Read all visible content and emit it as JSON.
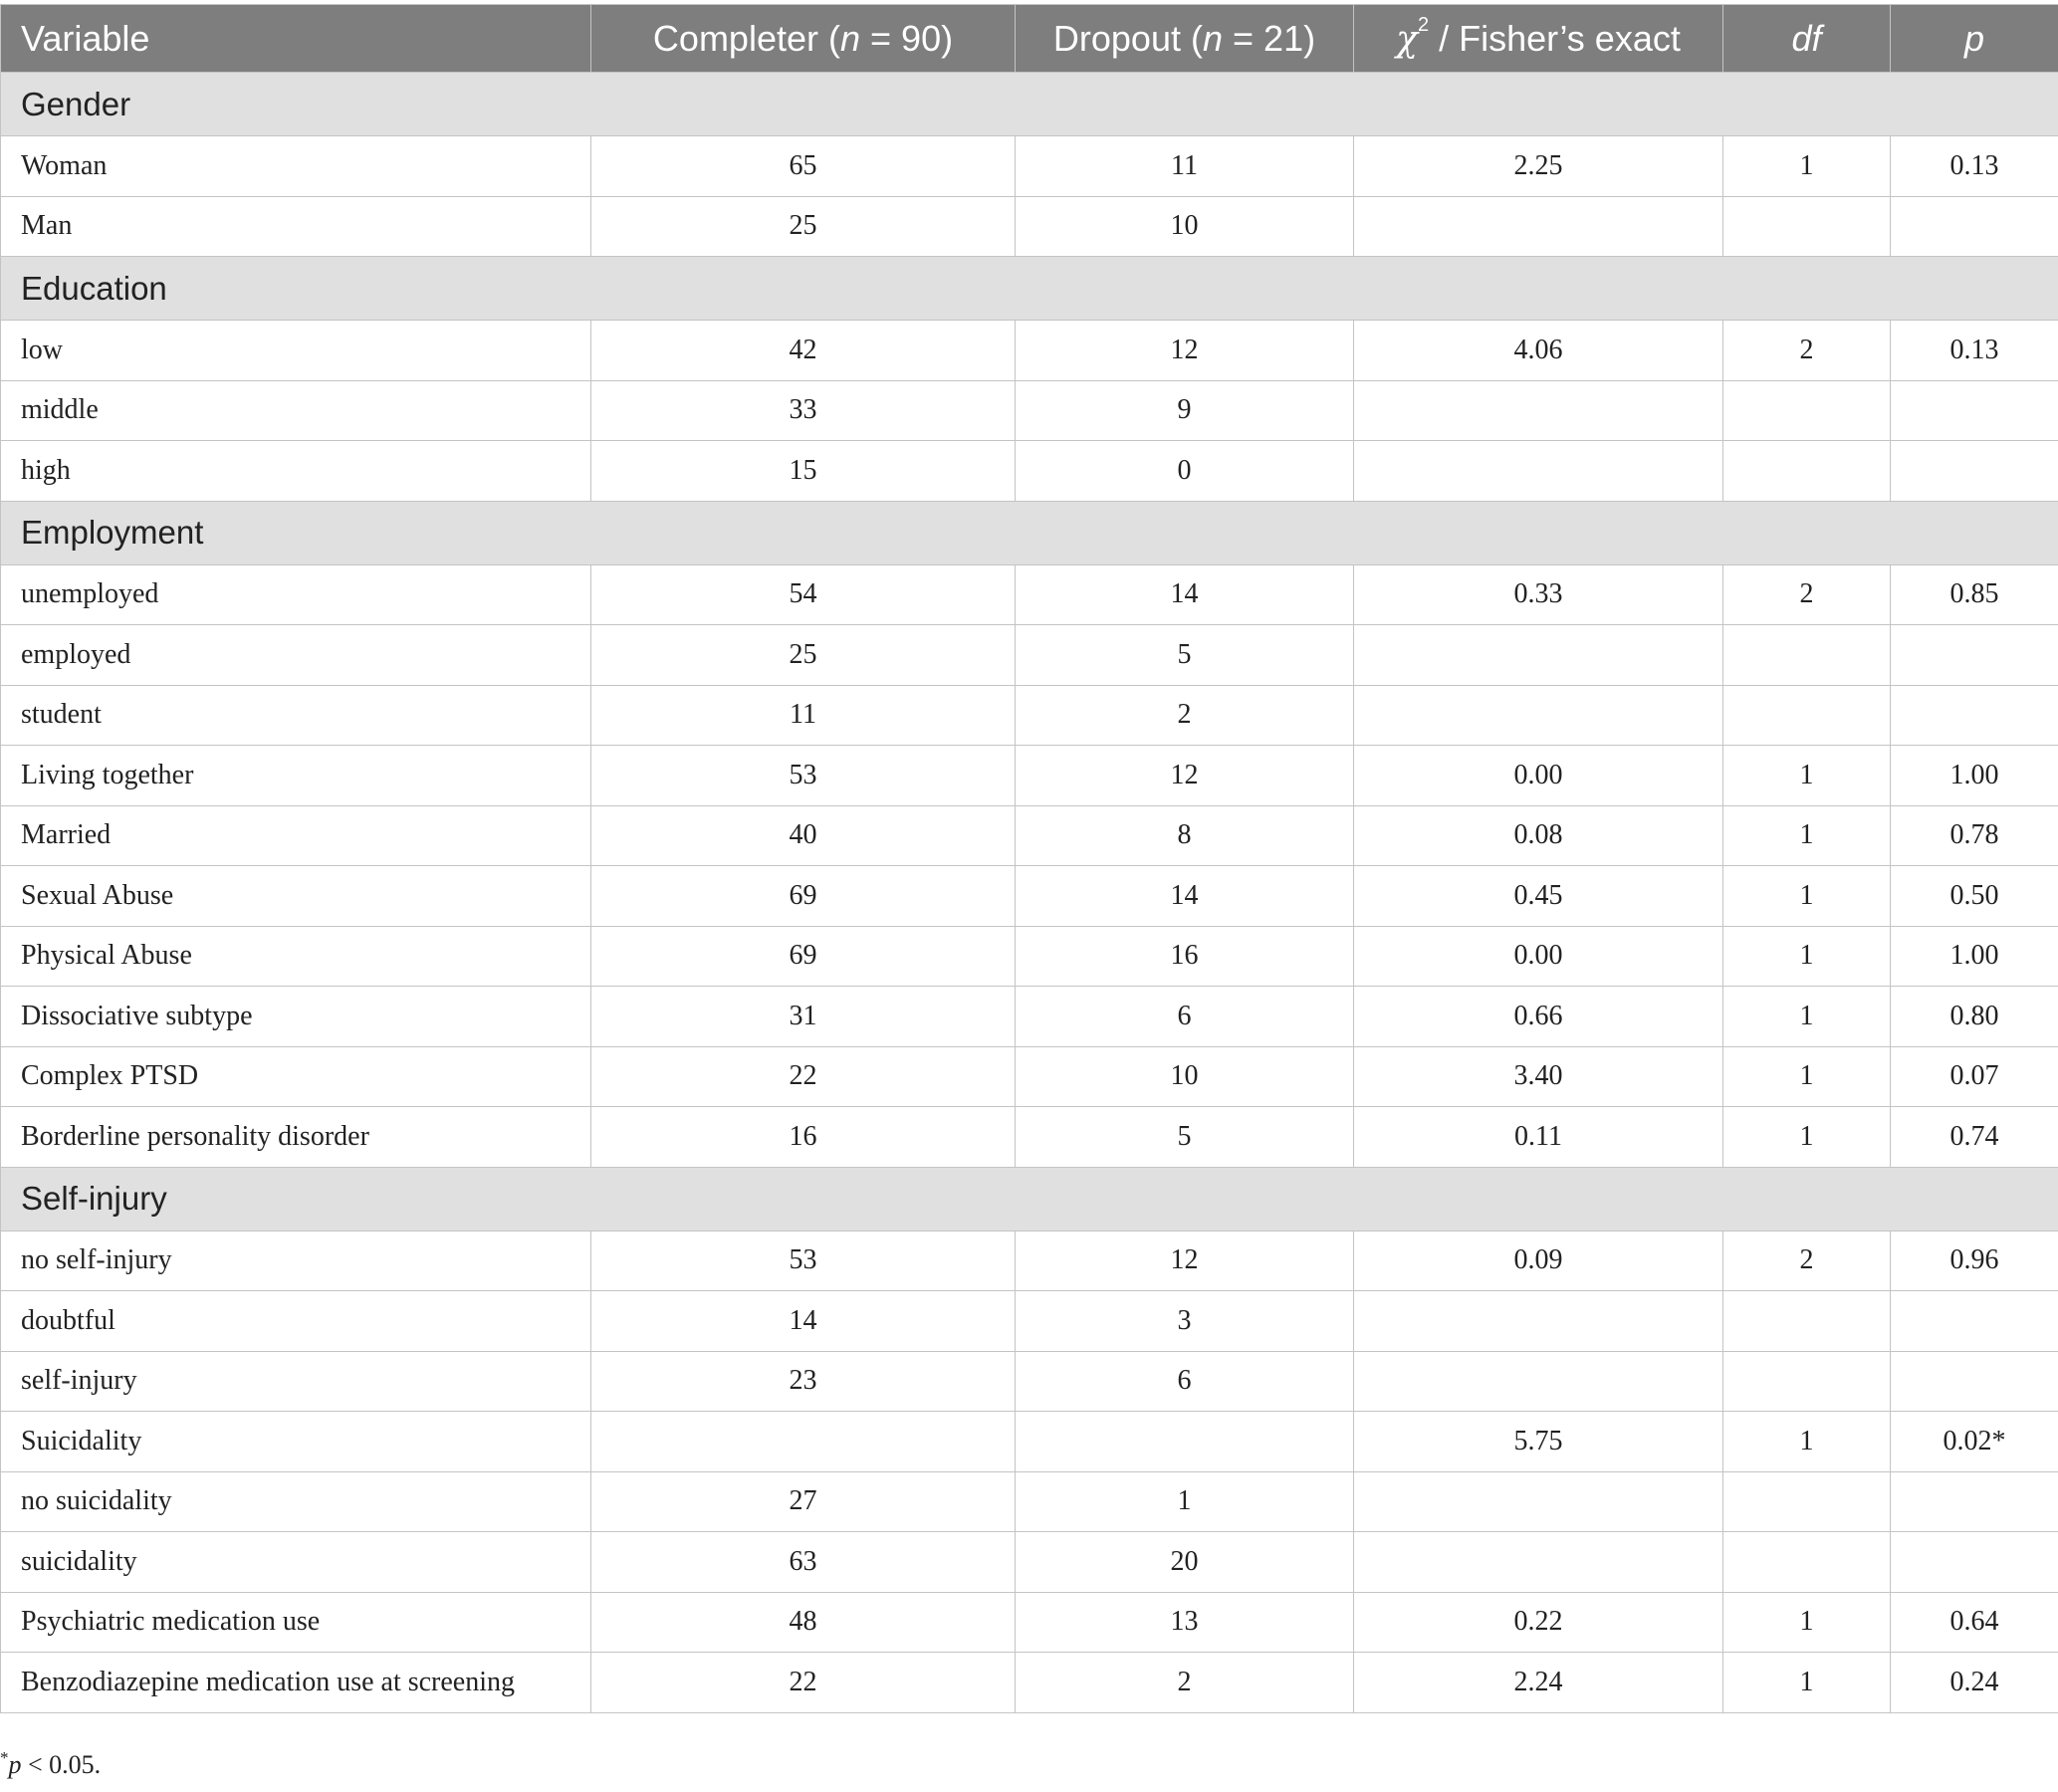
{
  "columns": {
    "variable": "Variable",
    "completer_prefix": "Completer (",
    "completer_n": "n",
    "completer_suffix": " = 90)",
    "dropout_prefix": "Dropout (",
    "dropout_n": "n",
    "dropout_suffix": " = 21)",
    "chi_symbol": "χ",
    "chi_superscript": "2",
    "chi_suffix": " / Fisher’s exact",
    "df": "df",
    "p": "p"
  },
  "rows": [
    {
      "section": "Gender"
    },
    {
      "label": "Woman",
      "completer": "65",
      "dropout": "11",
      "chi": "2.25",
      "df": "1",
      "p": "0.13"
    },
    {
      "label": "Man",
      "completer": "25",
      "dropout": "10",
      "chi": "",
      "df": "",
      "p": ""
    },
    {
      "section": "Education"
    },
    {
      "label": "low",
      "completer": "42",
      "dropout": "12",
      "chi": "4.06",
      "df": "2",
      "p": "0.13"
    },
    {
      "label": "middle",
      "completer": "33",
      "dropout": "9",
      "chi": "",
      "df": "",
      "p": ""
    },
    {
      "label": "high",
      "completer": "15",
      "dropout": "0",
      "chi": "",
      "df": "",
      "p": ""
    },
    {
      "section": "Employment"
    },
    {
      "label": "unemployed",
      "completer": "54",
      "dropout": "14",
      "chi": "0.33",
      "df": "2",
      "p": "0.85"
    },
    {
      "label": "employed",
      "completer": "25",
      "dropout": "5",
      "chi": "",
      "df": "",
      "p": ""
    },
    {
      "label": "student",
      "completer": "11",
      "dropout": "2",
      "chi": "",
      "df": "",
      "p": ""
    },
    {
      "label": "Living together",
      "completer": "53",
      "dropout": "12",
      "chi": "0.00",
      "df": "1",
      "p": "1.00"
    },
    {
      "label": "Married",
      "completer": "40",
      "dropout": "8",
      "chi": "0.08",
      "df": "1",
      "p": "0.78"
    },
    {
      "label": "Sexual Abuse",
      "completer": "69",
      "dropout": "14",
      "chi": "0.45",
      "df": "1",
      "p": "0.50"
    },
    {
      "label": "Physical Abuse",
      "completer": "69",
      "dropout": "16",
      "chi": "0.00",
      "df": "1",
      "p": "1.00"
    },
    {
      "label": "Dissociative subtype",
      "completer": "31",
      "dropout": "6",
      "chi": "0.66",
      "df": "1",
      "p": "0.80"
    },
    {
      "label": "Complex PTSD",
      "completer": "22",
      "dropout": "10",
      "chi": "3.40",
      "df": "1",
      "p": "0.07"
    },
    {
      "label": "Borderline personality disorder",
      "completer": "16",
      "dropout": "5",
      "chi": "0.11",
      "df": "1",
      "p": "0.74"
    },
    {
      "section": "Self-injury"
    },
    {
      "label": "no self-injury",
      "completer": "53",
      "dropout": "12",
      "chi": "0.09",
      "df": "2",
      "p": "0.96"
    },
    {
      "label": "doubtful",
      "completer": "14",
      "dropout": "3",
      "chi": "",
      "df": "",
      "p": ""
    },
    {
      "label": "self-injury",
      "completer": "23",
      "dropout": "6",
      "chi": "",
      "df": "",
      "p": ""
    },
    {
      "label": "Suicidality",
      "completer": "",
      "dropout": "",
      "chi": "5.75",
      "df": "1",
      "p": "0.02*"
    },
    {
      "label": "no suicidality",
      "completer": "27",
      "dropout": "1",
      "chi": "",
      "df": "",
      "p": ""
    },
    {
      "label": "suicidality",
      "completer": "63",
      "dropout": "20",
      "chi": "",
      "df": "",
      "p": ""
    },
    {
      "label": "Psychiatric medication use",
      "completer": "48",
      "dropout": "13",
      "chi": "0.22",
      "df": "1",
      "p": "0.64"
    },
    {
      "label": "Benzodiazepine medication use at screening",
      "completer": "22",
      "dropout": "2",
      "chi": "2.24",
      "df": "1",
      "p": "0.24"
    }
  ],
  "footnote": {
    "star": "*",
    "p": "p",
    "text": " < 0.05."
  }
}
